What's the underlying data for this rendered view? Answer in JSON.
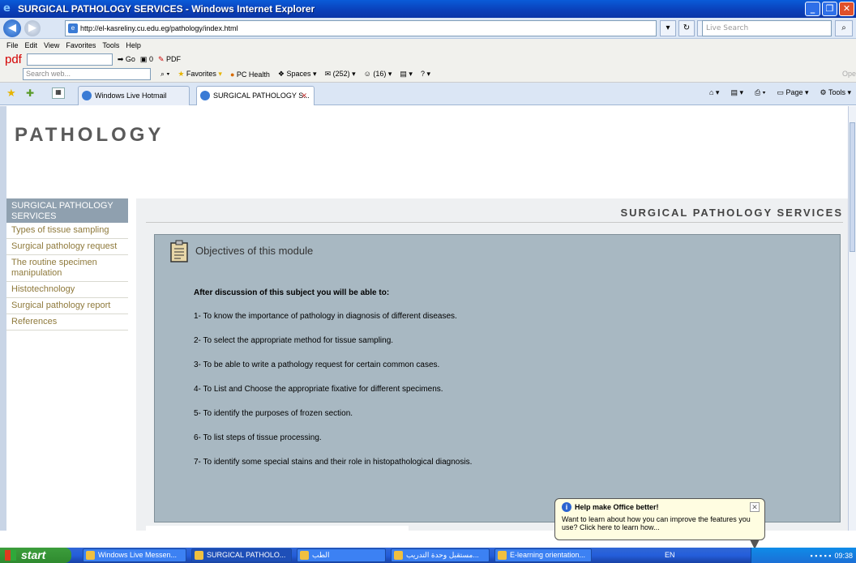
{
  "window": {
    "title": "SURGICAL PATHOLOGY SERVICES - Windows Internet Explorer"
  },
  "address_bar": {
    "url": "http://el-kasreliny.cu.edu.eg/pathology/index.html",
    "search_placeholder": "Live Search"
  },
  "menu": [
    "File",
    "Edit",
    "View",
    "Favorites",
    "Tools",
    "Help"
  ],
  "toolbar1": {
    "pdf_label": "pdf",
    "go_label": "Go",
    "count": "0",
    "pdf_btn": "PDF"
  },
  "toolbar2": {
    "search_placeholder": "Search web...",
    "favorites": "Favorites",
    "pc_health": "PC Health",
    "spaces": "Spaces",
    "mail_count": "(252)",
    "contacts_count": "(16)",
    "ope": "Ope"
  },
  "tabs": [
    {
      "label": "Windows Live Hotmail"
    },
    {
      "label": "SURGICAL PATHOLOGY S..."
    }
  ],
  "tab_tools": {
    "page": "Page",
    "tools": "Tools"
  },
  "site": {
    "brand": "PATHOLOGY",
    "header": "SURGICAL PATHOLOGY SERVICES"
  },
  "sidebar": {
    "active": "SURGICAL PATHOLOGY SERVICES",
    "items": [
      "Types of tissue sampling",
      "Surgical pathology request",
      "The routine specimen manipulation",
      "Histotechnology",
      "Surgical pathology report",
      "References"
    ]
  },
  "module": {
    "title": "Objectives of this module",
    "lead": "After discussion of this subject you will be able to:",
    "objectives": [
      "1- To know the importance of pathology in diagnosis of different diseases.",
      "2- To select the appropriate method for tissue sampling.",
      "3- To be able to write a pathology request for certain common cases.",
      "4- To List and Choose the appropriate fixative for different specimens.",
      "5- To identify the purposes of frozen section.",
      "6- To list steps of tissue processing.",
      "7- To identify some special stains and their role in histopathological diagnosis."
    ]
  },
  "balloon": {
    "title": "Help make Office better!",
    "text": "Want to learn about how you can improve the features you use?  Click here to learn how..."
  },
  "taskbar": {
    "start": "start",
    "items": [
      "Windows Live Messen...",
      "SURGICAL PATHOLO...",
      "الطب",
      "مستقبل وحدة التدريب...",
      "E-learning orientation..."
    ],
    "lang": "EN",
    "clock": "09:38"
  },
  "colors": {
    "sidebar_active": "#8fa0af",
    "sidebar_link": "#8f7a3c",
    "objectives_box": "#a8b8c2",
    "titlebar": "#0a3fb8"
  }
}
